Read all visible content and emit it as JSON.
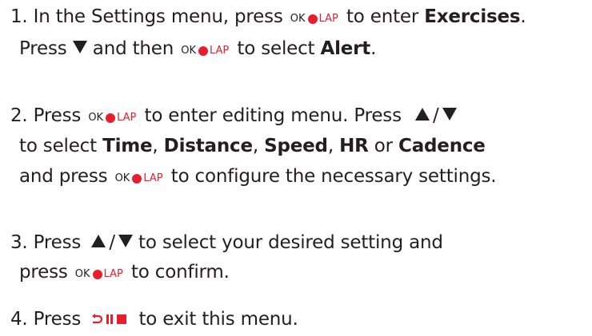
{
  "steps": [
    {
      "lines": [
        {
          "p1": "1. In the Settings menu, press",
          "p2": "to enter",
          "b1": "Exercises",
          "p3": "."
        },
        {
          "p1": "Press",
          "p2": "and then",
          "p3": "to select",
          "b1": "Alert",
          "p4": "."
        }
      ]
    },
    {
      "lines": [
        {
          "p1": "2. Press",
          "p2": "to enter editing menu. Press",
          "slash": "/"
        },
        {
          "p1": "to select",
          "b1": "Time",
          "s1": ",",
          "b2": "Distance",
          "s2": ",",
          "b3": "Speed",
          "s3": ",",
          "b4": "HR",
          "s4": "or",
          "b5": "Cadence"
        },
        {
          "p1": "and press",
          "p2": "to configure the necessary settings."
        }
      ]
    },
    {
      "lines": [
        {
          "p1": "3. Press",
          "slash": "/",
          "p2": "to select your desired setting and"
        },
        {
          "p1": "press",
          "p2": "to confirm."
        }
      ]
    },
    {
      "lines": [
        {
          "p1": "4. Press",
          "p2": "to exit this menu."
        }
      ]
    }
  ],
  "buttons": {
    "ok_text": "OK",
    "lap_text": "LAP"
  },
  "icons": {
    "ok_lap": "ok-lap-button-icon",
    "down": "down-arrow-icon",
    "up": "up-arrow-icon",
    "back_pause": "back-pause-stop-icon"
  },
  "colors": {
    "text": "#231f20",
    "accent_red": "#e5202e"
  }
}
